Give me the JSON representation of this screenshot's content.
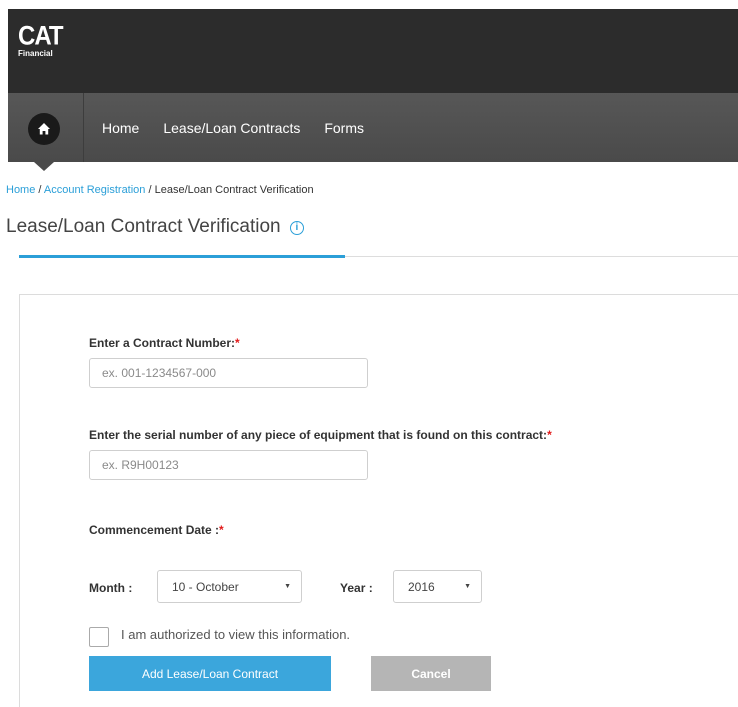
{
  "header": {
    "logo_text": "CAT",
    "logo_subtext": "Financial"
  },
  "nav": {
    "home_icon": "home-icon",
    "links": [
      "Home",
      "Lease/Loan Contracts",
      "Forms"
    ]
  },
  "breadcrumb": {
    "items": [
      "Home",
      "Account Registration",
      "Lease/Loan Contract Verification"
    ],
    "separator": "/"
  },
  "page": {
    "title": "Lease/Loan Contract Verification",
    "info_icon": "info-icon"
  },
  "form": {
    "contract_label": "Enter a Contract Number:",
    "contract_placeholder": "ex. 001-1234567-000",
    "serial_label": "Enter the serial number of any piece of equipment that is found on this contract:",
    "serial_placeholder": "ex. R9H00123",
    "date_label": "Commencement Date :",
    "required_marker": "*",
    "month_label": "Month :",
    "month_value": "10 - October",
    "year_label": "Year :",
    "year_value": "2016",
    "authorize_label": "I am authorized to view this information.",
    "submit_label": "Add Lease/Loan Contract",
    "cancel_label": "Cancel"
  },
  "colors": {
    "accent": "#2b9fd8",
    "header_bg": "#2c2c2c",
    "nav_bg": "#4f4f4f",
    "primary_button": "#3ba6dc",
    "cancel_button": "#b5b5b5",
    "required": "#e21a1a"
  }
}
